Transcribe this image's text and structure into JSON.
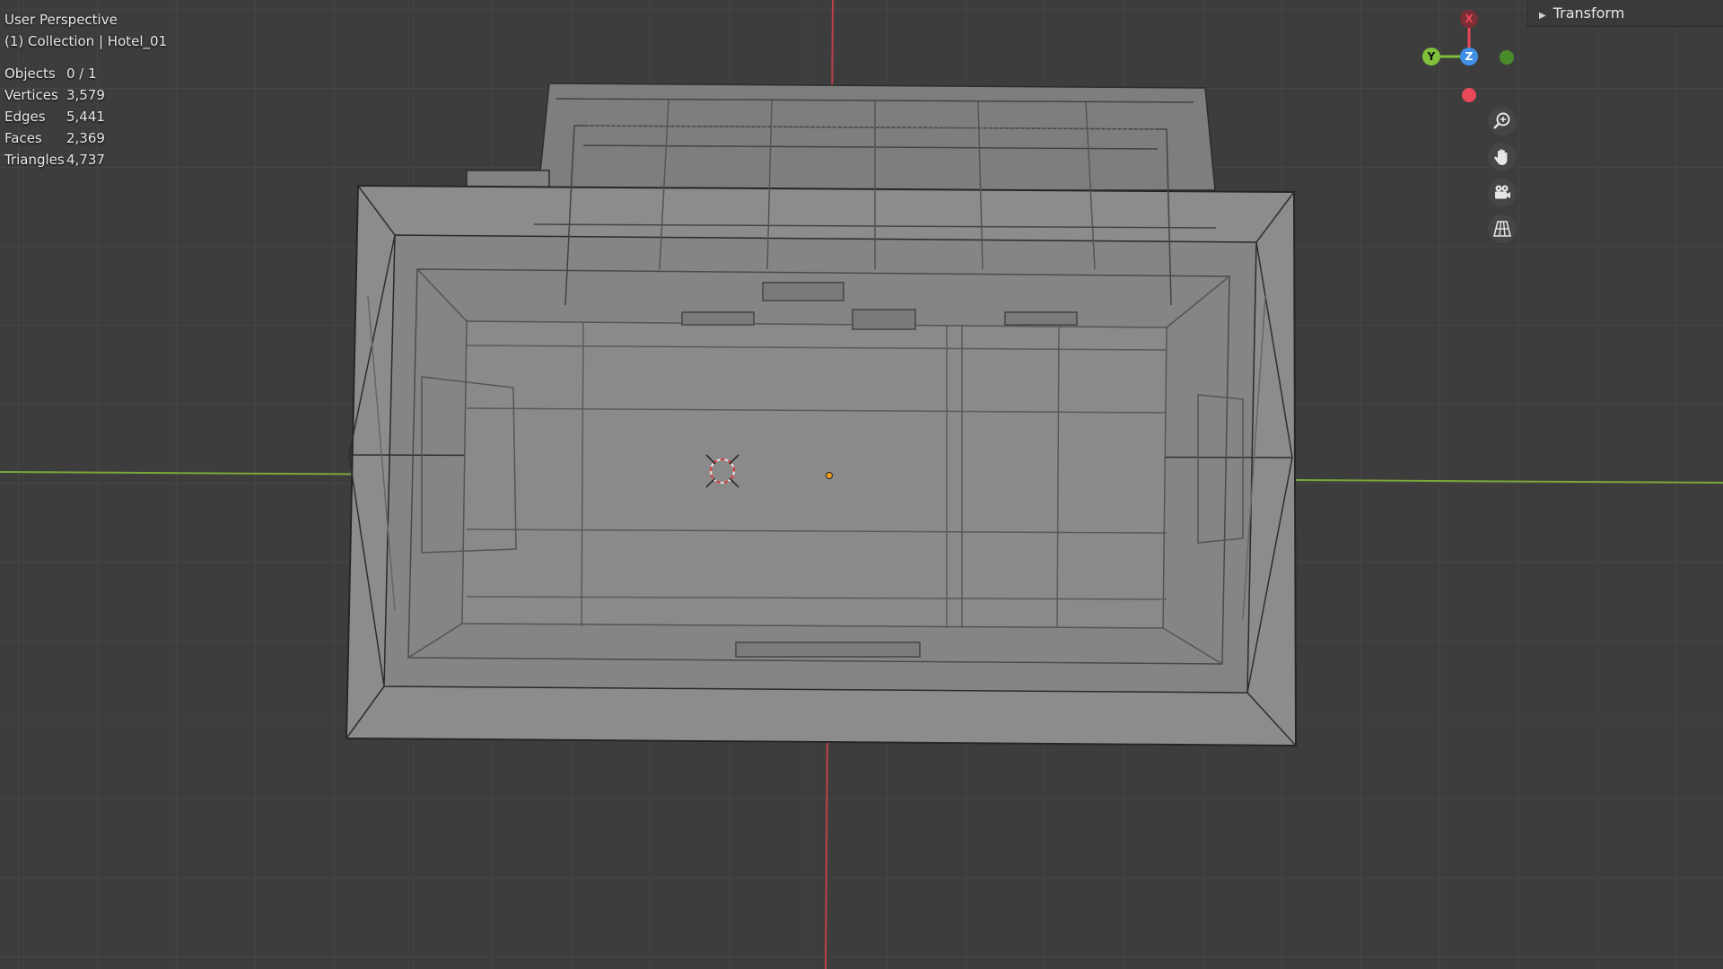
{
  "viewport": {
    "view_name": "User Perspective",
    "collection_label": "(1) Collection | Hotel_01"
  },
  "stats": [
    {
      "label": "Objects",
      "value": "0 / 1"
    },
    {
      "label": "Vertices",
      "value": "3,579"
    },
    {
      "label": "Edges",
      "value": "5,441"
    },
    {
      "label": "Faces",
      "value": "2,369"
    },
    {
      "label": "Triangles",
      "value": "4,737"
    }
  ],
  "sidebar": {
    "transform_label": "Transform"
  },
  "gizmo": {
    "x_label": "X",
    "y_label": "Y",
    "z_label": "Z"
  },
  "icons": {
    "zoom": "zoom-icon",
    "pan": "hand-pan-icon",
    "camera": "camera-view-icon",
    "projection": "perspective-grid-icon"
  },
  "colors": {
    "background": "#3d3d3d",
    "x_axis": "#e8485a",
    "y_axis": "#7ec03a",
    "z_axis": "#3f8ee8"
  }
}
